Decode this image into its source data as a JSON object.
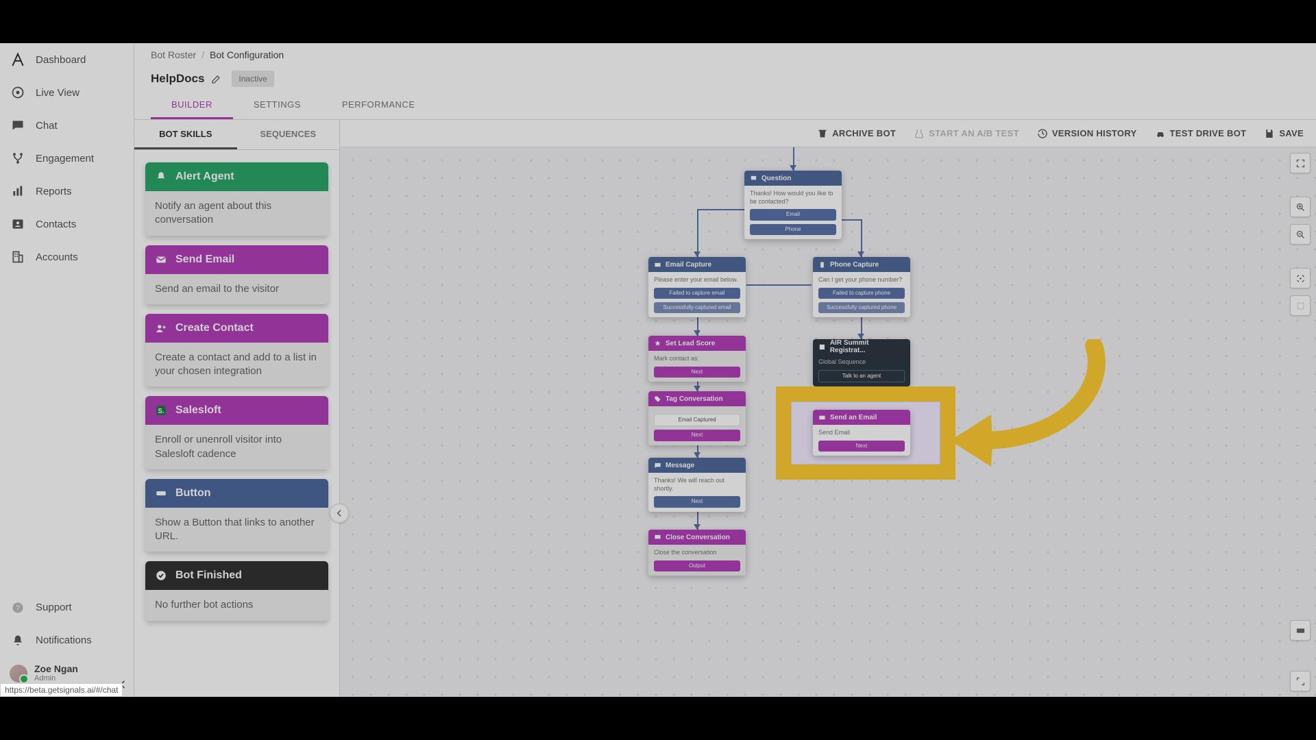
{
  "sidebar": {
    "items": [
      {
        "label": "Dashboard",
        "icon": "logo-a-icon"
      },
      {
        "label": "Live View",
        "icon": "eye-icon"
      },
      {
        "label": "Chat",
        "icon": "chat-icon"
      },
      {
        "label": "Engagement",
        "icon": "branch-icon"
      },
      {
        "label": "Reports",
        "icon": "bar-icon"
      },
      {
        "label": "Contacts",
        "icon": "person-icon"
      },
      {
        "label": "Accounts",
        "icon": "building-icon"
      }
    ],
    "support": "Support",
    "notifications": "Notifications",
    "user": {
      "name": "Zoe Ngan",
      "role": "Admin"
    }
  },
  "breadcrumb": {
    "root": "Bot Roster",
    "current": "Bot Configuration"
  },
  "bot": {
    "name": "HelpDocs",
    "status": "Inactive"
  },
  "tabs": [
    "BUILDER",
    "SETTINGS",
    "PERFORMANCE"
  ],
  "activeTab": "BUILDER",
  "actions": {
    "archive": "ARCHIVE BOT",
    "abtest": "START AN A/B TEST",
    "history": "VERSION HISTORY",
    "testdrive": "TEST DRIVE BOT",
    "save": "SAVE"
  },
  "skillTabs": [
    "BOT SKILLS",
    "SEQUENCES"
  ],
  "activeSkillTab": "BOT SKILLS",
  "skills": [
    {
      "title": "Alert Agent",
      "icon": "bell-icon",
      "head": "sh-green",
      "desc": "Notify an agent about this conversation"
    },
    {
      "title": "Send Email",
      "icon": "mail-icon",
      "head": "sh-purple",
      "desc": "Send an email to the visitor"
    },
    {
      "title": "Create Contact",
      "icon": "person-plus-icon",
      "head": "sh-purple",
      "desc": "Create a contact and add to a list in your chosen integration"
    },
    {
      "title": "Salesloft",
      "icon": "square-s-icon",
      "head": "sh-purple",
      "desc": "Enroll or unenroll visitor into Salesloft cadence"
    },
    {
      "title": "Button",
      "icon": "button-icon",
      "head": "sh-blue",
      "desc": "Show a Button that links to another URL."
    },
    {
      "title": "Bot Finished",
      "icon": "check-icon",
      "head": "sh-dark",
      "desc": "No further bot actions"
    }
  ],
  "nodes": {
    "question": {
      "title": "Question",
      "body": "Thanks! How would you like to be contacted?",
      "opt1": "Email",
      "opt2": "Phone"
    },
    "emailcap": {
      "title": "Email Capture",
      "body": "Please enter your email below.",
      "fail": "Failed to capture email",
      "ok": "Successfully captured email"
    },
    "phonecap": {
      "title": "Phone Capture",
      "body": "Can I get your phone number?",
      "fail": "Failed to capture phone",
      "ok": "Successfully captured phone"
    },
    "leadscore": {
      "title": "Set Lead Score",
      "body": "Mark contact as:",
      "next": "Next"
    },
    "airsummit": {
      "title": "AIR Summit Registrat...",
      "sub": "Global Sequence",
      "btn": "Talk to an agent"
    },
    "tagconv": {
      "title": "Tag Conversation",
      "body": "Email Captured",
      "next": "Next"
    },
    "sendemail": {
      "title": "Send an Email",
      "body": "Send Email",
      "next": "Next"
    },
    "message": {
      "title": "Message",
      "body": "Thanks! We will reach out shortly.",
      "next": "Next"
    },
    "closeconv": {
      "title": "Close Conversation",
      "body": "Close the conversation",
      "out": "Output"
    }
  },
  "statusUrl": "https://beta.getsignals.ai/#/chat"
}
